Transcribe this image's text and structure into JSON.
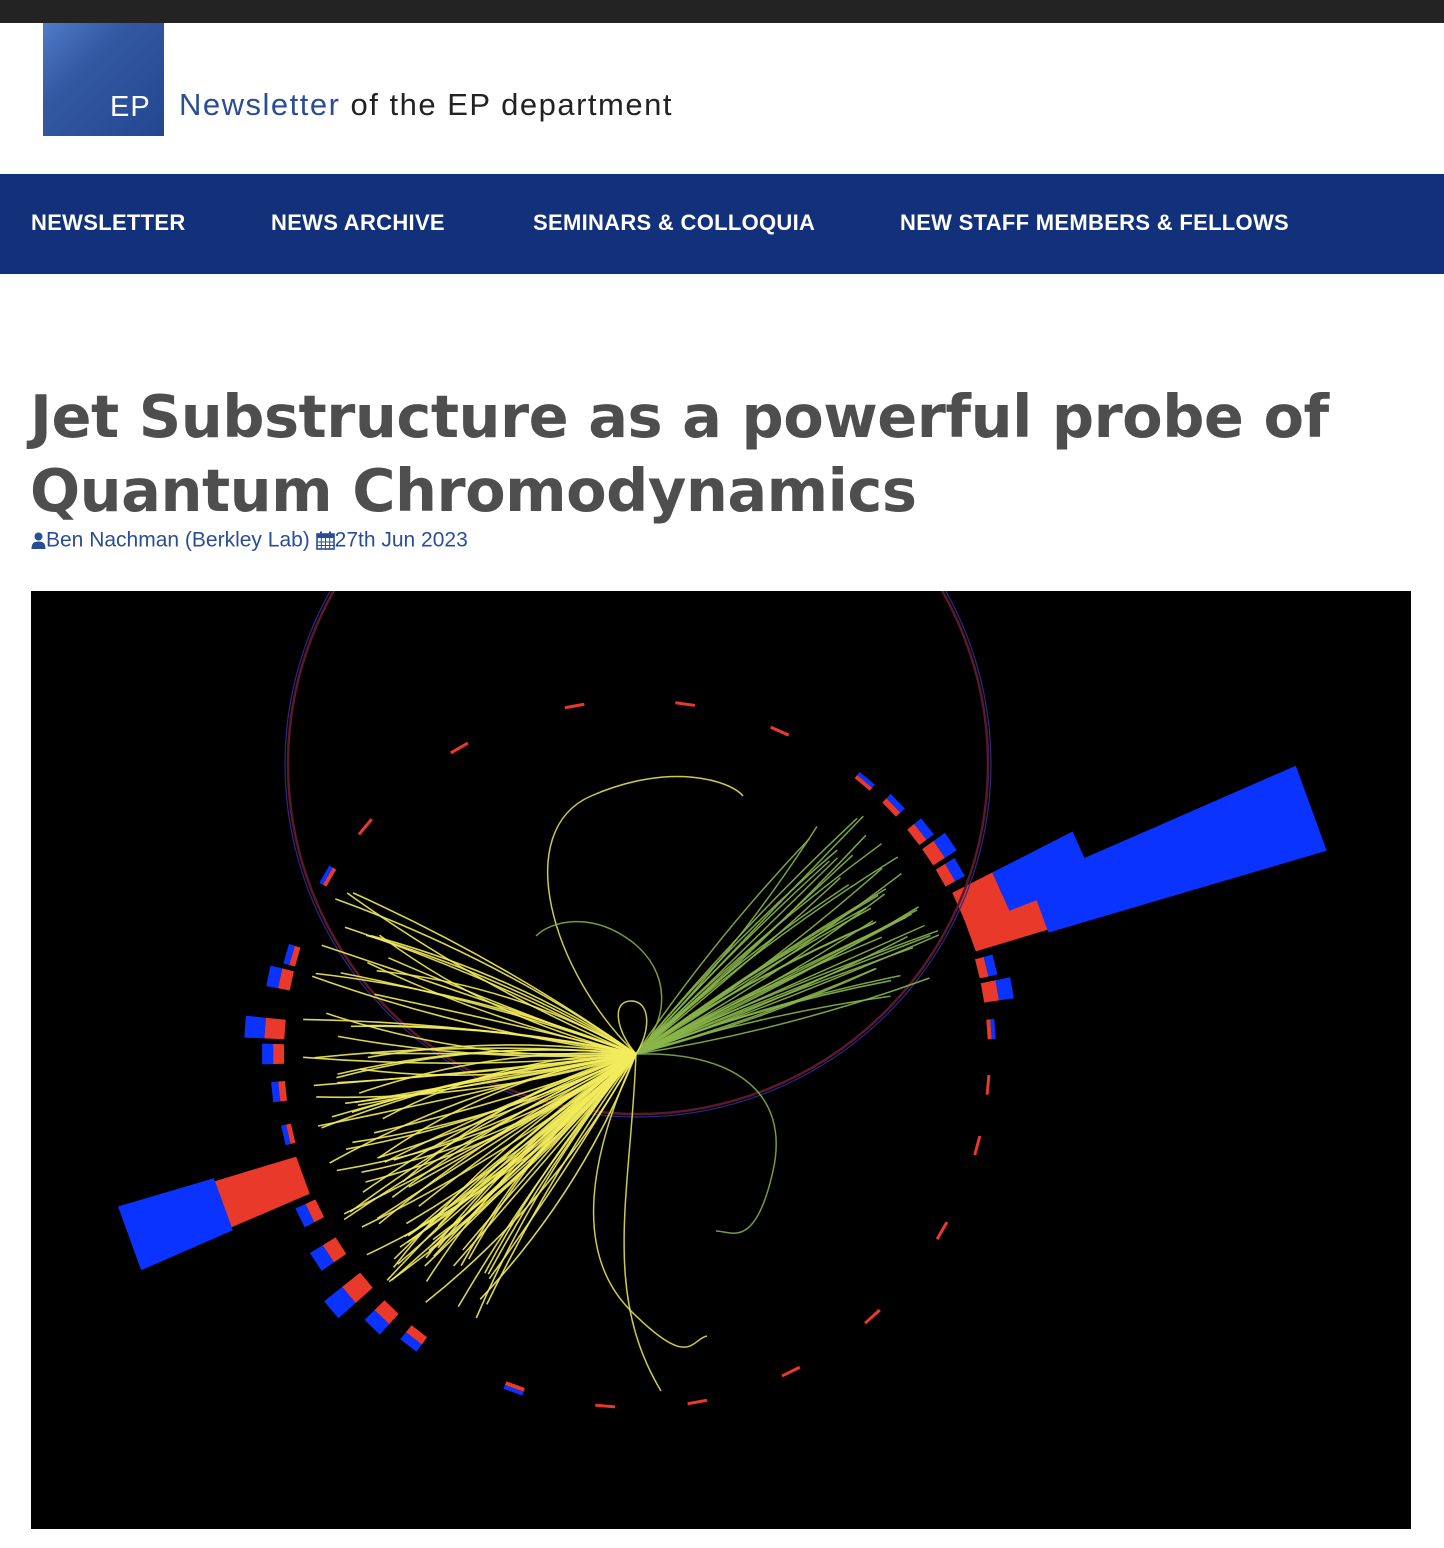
{
  "header": {
    "logo_text": "EP",
    "title_part1": "Newsletter",
    "title_part2": " of the EP department"
  },
  "nav": {
    "items": [
      {
        "label": "NEWSLETTER"
      },
      {
        "label": "NEWS ARCHIVE"
      },
      {
        "label": "SEMINARS & COLLOQUIA"
      },
      {
        "label": "NEW STAFF MEMBERS & FELLOWS"
      }
    ]
  },
  "article": {
    "title": "Jet Substructure as a powerful probe of Quantum Chromodynamics",
    "author": "Ben Nachman (Berkley Lab)",
    "date": "27th Jun 2023"
  },
  "icons": {
    "author": "user-icon",
    "date": "calendar-icon"
  },
  "colors": {
    "nav_bg": "#13307a",
    "accent_blue": "#2a4e95",
    "title_gray": "#4e4e4e",
    "track_yellow": "#f2ec5c",
    "track_green": "#8ab54a",
    "deposit_red": "#e8392a",
    "deposit_blue": "#0b33ff"
  }
}
